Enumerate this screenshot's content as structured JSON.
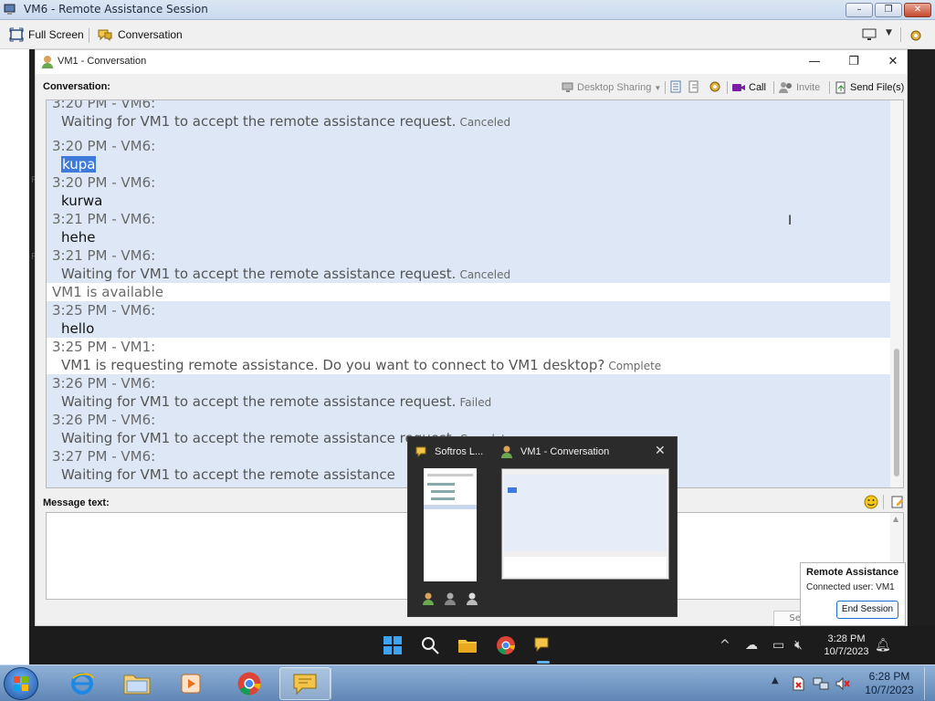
{
  "window": {
    "title": "VM6 - Remote Assistance Session"
  },
  "toolbar": {
    "fullscreen_label": "Full Screen",
    "conversation_label": "Conversation"
  },
  "remote_strip": {
    "letters": [
      "R",
      "R"
    ]
  },
  "conversation_window": {
    "title": "VM1 - Conversation",
    "section_label": "Conversation:",
    "tools": {
      "desktop_sharing": "Desktop Sharing",
      "call": "Call",
      "invite": "Invite",
      "send_files": "Send File(s)"
    },
    "messages": [
      {
        "header": "3:20 PM - VM6:",
        "body": "Waiting for VM1 to accept the remote assistance request.",
        "status": "Canceled",
        "shaded": true
      },
      {
        "header": "3:20 PM - VM6:",
        "body": "kupa",
        "selected": true,
        "shaded": true
      },
      {
        "header": "3:20 PM - VM6:",
        "body": "kurwa",
        "shaded": true
      },
      {
        "header": "3:21 PM - VM6:",
        "body": "hehe",
        "shaded": true
      },
      {
        "header": "3:21 PM - VM6:",
        "body": "Waiting for VM1 to accept the remote assistance request.",
        "status": "Canceled",
        "shaded": true
      },
      {
        "system": "VM1 is available"
      },
      {
        "header": "3:25 PM - VM6:",
        "body": "hello",
        "shaded": true
      },
      {
        "header": "3:25 PM - VM1:",
        "body": "VM1 is requesting remote assistance. Do you want to connect to VM1 desktop?",
        "status": "Complete",
        "shaded": false
      },
      {
        "header": "3:26 PM - VM6:",
        "body": "Waiting for VM1 to accept the remote assistance request.",
        "status": "Failed",
        "shaded": true
      },
      {
        "header": "3:26 PM - VM6:",
        "body": "Waiting for VM1 to accept the remote assistance request.",
        "status": "Complete",
        "shaded": true
      },
      {
        "header": "3:27 PM - VM6:",
        "body": "Waiting for VM1 to accept the remote assistance",
        "shaded": true
      }
    ],
    "message_text_label": "Message text:",
    "message_value": "",
    "send_label": "Send"
  },
  "taskbar_preview": {
    "item1_title": "Softros L...",
    "item2_title": "VM1 - Conversation"
  },
  "remote_assistance_popup": {
    "title": "Remote Assistance",
    "connected_user": "Connected user: VM1",
    "end_button": "End Session"
  },
  "remote_taskbar": {
    "time": "3:28 PM",
    "date": "10/7/2023"
  },
  "host_taskbar": {
    "time": "6:28 PM",
    "date": "10/7/2023"
  },
  "colors": {
    "accent": "#3f79d9",
    "shaded_row": "#dde7f5",
    "win11_bar": "#1c1c1c"
  }
}
